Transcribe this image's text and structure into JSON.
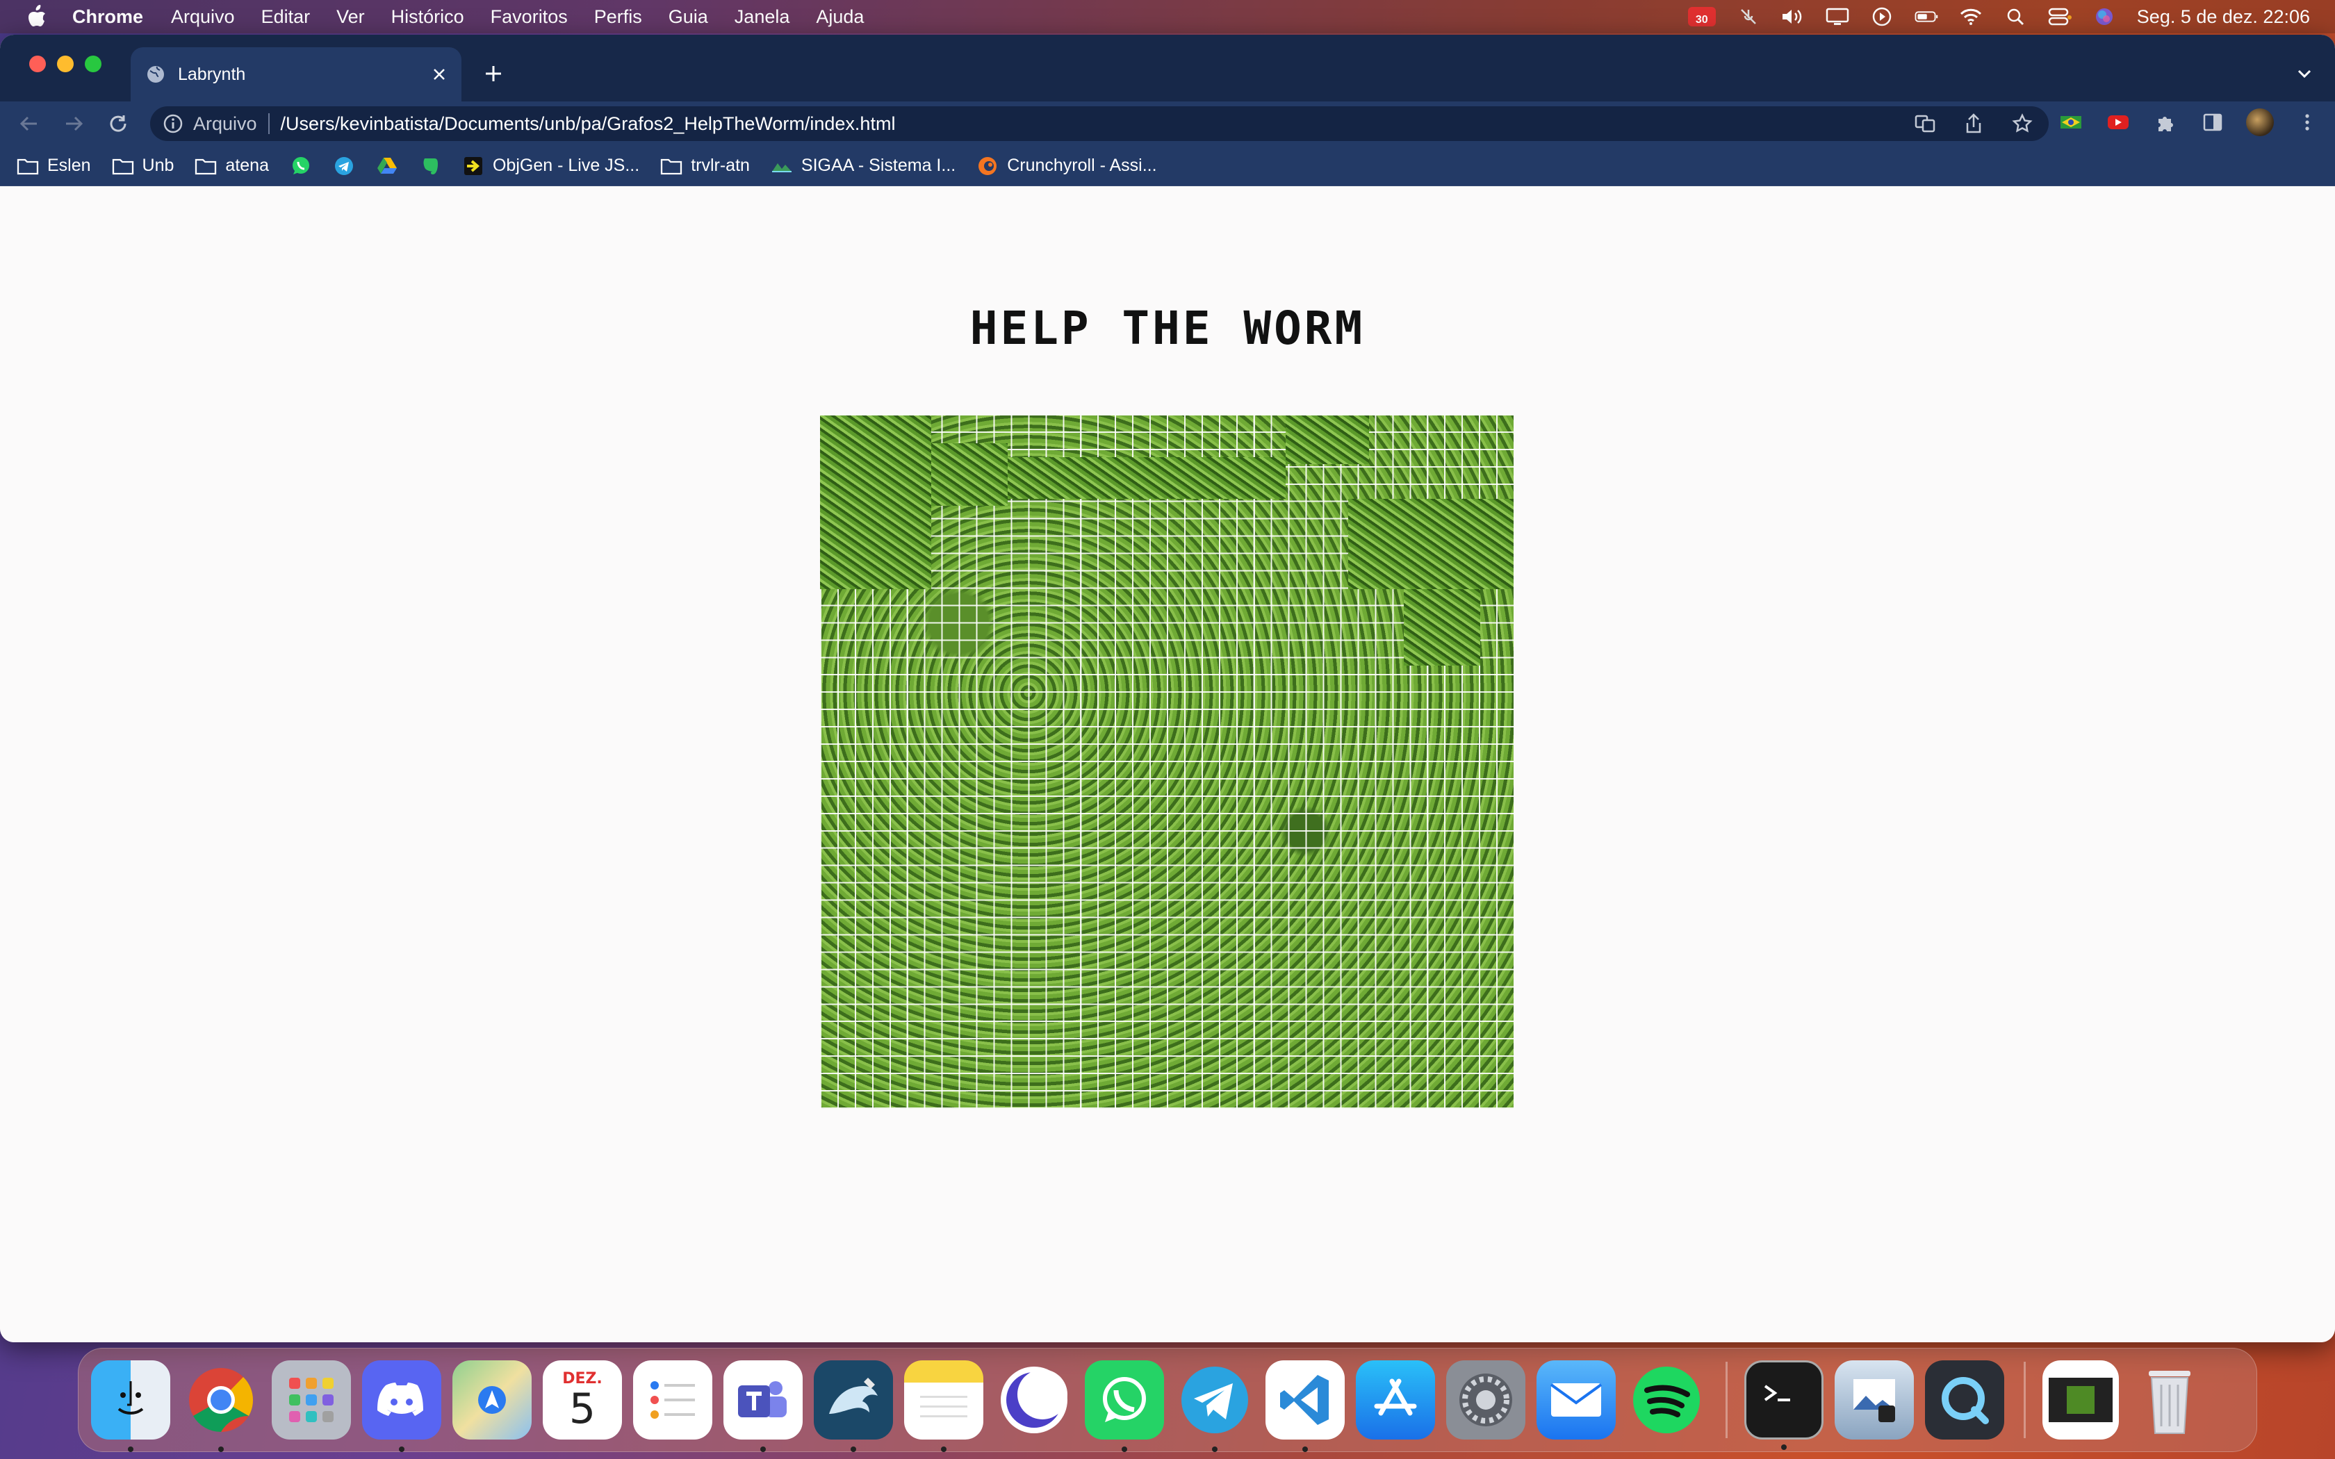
{
  "menubar": {
    "app_name": "Chrome",
    "items": [
      "Arquivo",
      "Editar",
      "Ver",
      "Histórico",
      "Favoritos",
      "Perfis",
      "Guia",
      "Janela",
      "Ajuda"
    ],
    "badge_count": "30",
    "clock": "Seg. 5 de dez.  22:06"
  },
  "browser": {
    "tab": {
      "title": "Labrynth"
    },
    "omnibox": {
      "scheme_label": "Arquivo",
      "url": "/Users/kevinbatista/Documents/unb/pa/Grafos2_HelpTheWorm/index.html"
    },
    "bookmarks": [
      {
        "label": "Eslen",
        "icon": "folder-icon"
      },
      {
        "label": "Unb",
        "icon": "folder-icon"
      },
      {
        "label": "atena",
        "icon": "folder-icon"
      },
      {
        "label": "",
        "icon": "whatsapp-icon"
      },
      {
        "label": "",
        "icon": "telegram-icon"
      },
      {
        "label": "",
        "icon": "google-drive-icon"
      },
      {
        "label": "",
        "icon": "evernote-icon"
      },
      {
        "label": "ObjGen - Live JS...",
        "icon": "objgen-icon"
      },
      {
        "label": "trvlr-atn",
        "icon": "folder-icon"
      },
      {
        "label": "SIGAA - Sistema I...",
        "icon": "sigaa-icon"
      },
      {
        "label": "Crunchyroll - Assi...",
        "icon": "crunchyroll-icon"
      }
    ]
  },
  "page": {
    "title": "Help the worm"
  },
  "dock": {
    "calendar_month": "DEZ.",
    "calendar_day": "5",
    "apps": [
      "Finder",
      "Chrome",
      "Launchpad",
      "Discord",
      "Maps",
      "Calendar",
      "Reminders",
      "Teams",
      "MySQL Workbench",
      "Notes",
      "Eclipse",
      "WhatsApp",
      "Telegram",
      "VS Code",
      "App Store",
      "System Preferences",
      "Mail",
      "Spotify",
      "Terminal",
      "Preview",
      "QuickTime",
      "Screenshot",
      "Trash"
    ]
  }
}
